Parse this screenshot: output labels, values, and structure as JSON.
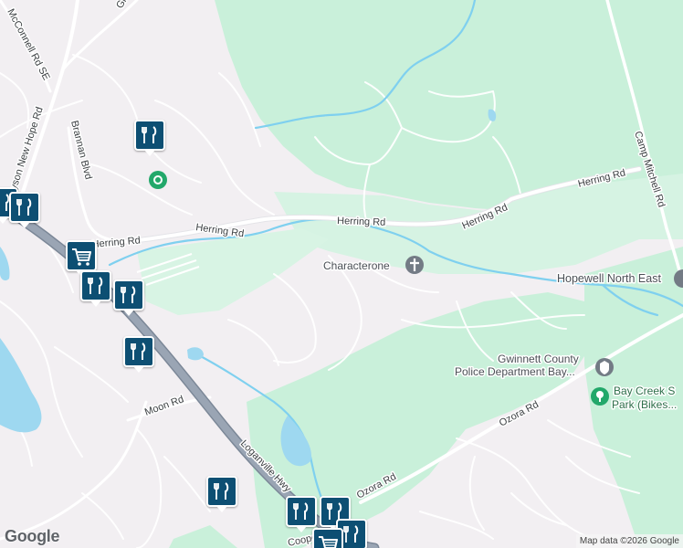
{
  "map": {
    "colors": {
      "land": "#f2eff2",
      "park": "#c9f0da",
      "park_light": "#d8f4e4",
      "water": "#9ed8f0",
      "water_stroke": "#7fd0ef",
      "road": "#ffffff",
      "road_minor": "#ffffff",
      "highway": "#9aa5b4",
      "marker": "#0d4f73",
      "poi_green": "#22a86a",
      "poi_gray": "#737b85"
    },
    "roads": {
      "herring_rd_1": "Herring Rd",
      "herring_rd_2": "Herring Rd",
      "herring_rd_3": "Herring Rd",
      "herring_rd_4": "Herring Rd",
      "herring_rd_5": "Herring Rd",
      "mcconnell": "McConnell Rd SE",
      "grayson": "Grayson New Hope Rd",
      "brannan": "Brannan Blvd",
      "camp_mitchell": "Camp Mitchell Rd",
      "moon": "Moon Rd",
      "loganville": "Loganville Hwy",
      "ozora_1": "Ozora Rd",
      "ozora_2": "Ozora Rd",
      "gr_top": "Gr",
      "cooper": "Coope"
    },
    "pois": {
      "characterone": "Characterone",
      "hopewell": "Hopewell North East",
      "police_line1": "Gwinnett County",
      "police_line2": "Police Department Bay...",
      "park_line1": "Bay Creek S",
      "park_line2": "Park (Bikes..."
    },
    "markers": [
      {
        "icon": "restaurant-icon"
      },
      {
        "icon": "restaurant-icon"
      },
      {
        "icon": "restaurant-icon"
      },
      {
        "icon": "shopping-cart-icon"
      },
      {
        "icon": "restaurant-icon"
      },
      {
        "icon": "restaurant-icon"
      },
      {
        "icon": "restaurant-icon"
      },
      {
        "icon": "restaurant-icon"
      },
      {
        "icon": "restaurant-icon"
      },
      {
        "icon": "restaurant-icon"
      },
      {
        "icon": "shopping-cart-icon"
      },
      {
        "icon": "restaurant-icon"
      }
    ],
    "branding": {
      "logo": "Google",
      "attribution": "Map data ©2026 Google"
    }
  }
}
